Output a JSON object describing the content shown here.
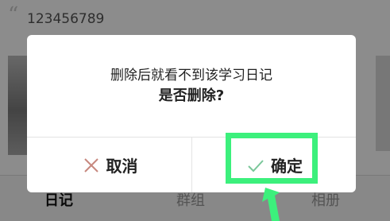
{
  "background": {
    "quote_mark": "“",
    "entry_text": "123456789",
    "tabs": [
      "日记",
      "群组",
      "相册"
    ]
  },
  "dialog": {
    "message": "删除后就看不到该学习日记",
    "question": "是否删除?",
    "cancel_label": "取消",
    "confirm_label": "确定",
    "cancel_icon": "close-x-icon",
    "confirm_icon": "checkmark-icon"
  },
  "annotation": {
    "highlight_color": "#3cf07c",
    "target": "confirm-button"
  },
  "colors": {
    "cancel_icon": "#c7887f",
    "confirm_icon": "#7ac79a",
    "highlight": "#3cf07c"
  }
}
